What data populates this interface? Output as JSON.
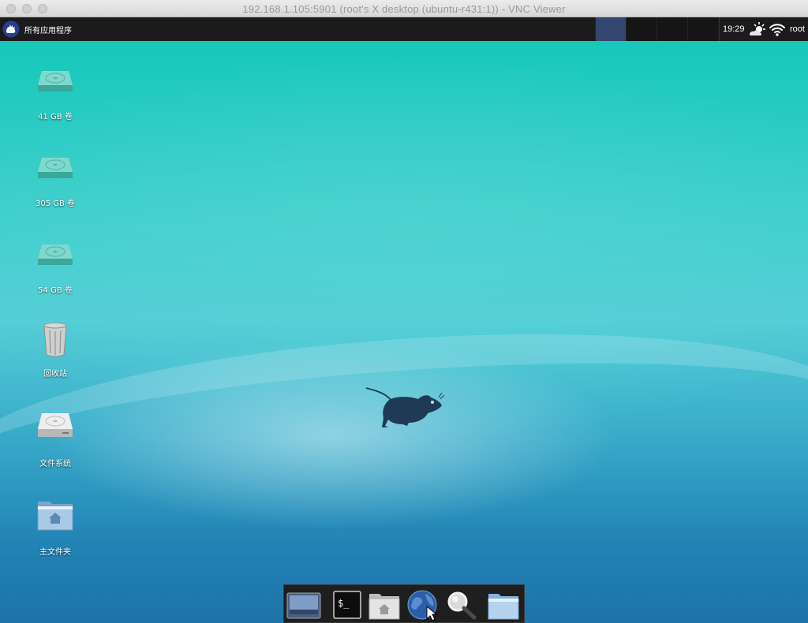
{
  "window": {
    "title": "192.168.1.105:5901 (root's X desktop (ubuntu-r431:1)) - VNC Viewer",
    "traffic_lights": [
      "close",
      "minimize",
      "zoom"
    ]
  },
  "panel": {
    "menu_label": "所有应用程序",
    "workspaces": 4,
    "active_workspace": 1,
    "clock": "19:29",
    "user": "root",
    "tray_icons": [
      "weather-icon",
      "wifi-icon"
    ]
  },
  "desktop": {
    "icons": [
      {
        "label": "41 GB 卷",
        "icon": "drive-icon"
      },
      {
        "label": "305 GB 卷",
        "icon": "drive-icon"
      },
      {
        "label": "54 GB 卷",
        "icon": "drive-icon"
      },
      {
        "label": "回收站",
        "icon": "trash-icon"
      },
      {
        "label": "文件系统",
        "icon": "filesystem-drive-icon"
      },
      {
        "label": "主文件夹",
        "icon": "home-folder-icon"
      }
    ],
    "wallpaper": "xfce-mouse",
    "colors": {
      "top": "#16c8ba",
      "bottom": "#1d73aa",
      "mouse": "#1f3a55"
    }
  },
  "dock": {
    "items": [
      {
        "name": "show-desktop",
        "icon": "desktop-icon"
      },
      {
        "name": "terminal",
        "icon": "terminal-icon",
        "text": "$_"
      },
      {
        "name": "home-files",
        "icon": "home-folder-icon"
      },
      {
        "name": "web-browser",
        "icon": "globe-icon"
      },
      {
        "name": "app-finder",
        "icon": "magnifier-icon"
      },
      {
        "name": "file-manager",
        "icon": "folder-icon"
      }
    ]
  }
}
